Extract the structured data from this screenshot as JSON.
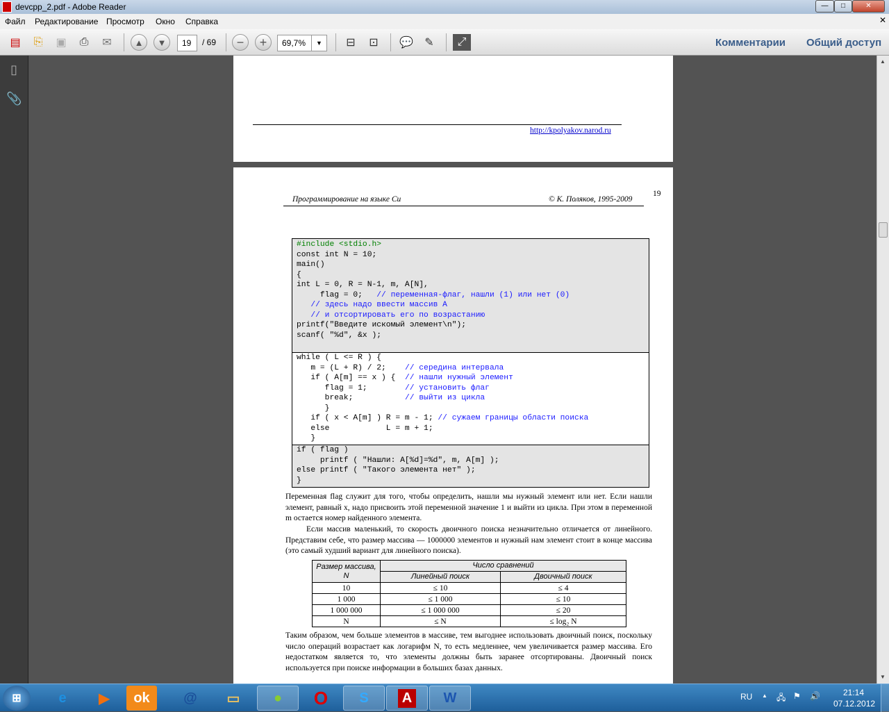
{
  "window": {
    "title": "devcpp_2.pdf - Adobe Reader",
    "min": "—",
    "max": "□",
    "close": "✕"
  },
  "menu": [
    "Файл",
    "Редактирование",
    "Просмотр",
    "Окно",
    "Справка"
  ],
  "toolbar": {
    "page_current": "19",
    "page_total": "/ 69",
    "zoom": "69,7%",
    "comments": "Комментарии",
    "share": "Общий доступ"
  },
  "page1": {
    "link": "http://kpolyakov.narod.ru"
  },
  "page2": {
    "header_left": "Программирование на языке Си",
    "header_right": "© К. Поляков, 1995-2009",
    "page_number": "19",
    "code_top": [
      {
        "parts": [
          {
            "t": "#include <stdio.h>",
            "c": "pp"
          }
        ]
      },
      {
        "parts": [
          {
            "t": "const int N = 10;"
          }
        ]
      },
      {
        "parts": [
          {
            "t": "main()"
          }
        ]
      },
      {
        "parts": [
          {
            "t": "{"
          }
        ]
      },
      {
        "parts": [
          {
            "t": "int L = 0, R = N-1, m, A[N],"
          }
        ]
      },
      {
        "parts": [
          {
            "t": "     flag = 0;   "
          },
          {
            "t": "// переменная-флаг, нашли (1) или нет (0)",
            "c": "cm"
          }
        ]
      },
      {
        "parts": [
          {
            "t": "   // здесь надо ввести массив A",
            "c": "cm"
          }
        ]
      },
      {
        "parts": [
          {
            "t": "   // и отсортировать его по возрастанию",
            "c": "cm"
          }
        ]
      },
      {
        "parts": [
          {
            "t": "printf(\"Введите искомый элемент\\n\");"
          }
        ]
      },
      {
        "parts": [
          {
            "t": "scanf( \"%d\", &x );"
          }
        ]
      }
    ],
    "code_mid": [
      {
        "parts": [
          {
            "t": "while ( L <= R ) {"
          }
        ]
      },
      {
        "parts": [
          {
            "t": "   m = (L + R) / 2;    "
          },
          {
            "t": "// середина интервала",
            "c": "cm"
          }
        ]
      },
      {
        "parts": [
          {
            "t": "   if ( A[m] == x ) {  "
          },
          {
            "t": "// нашли нужный элемент",
            "c": "cm"
          }
        ]
      },
      {
        "parts": [
          {
            "t": "      flag = 1;        "
          },
          {
            "t": "// установить флаг",
            "c": "cm"
          }
        ]
      },
      {
        "parts": [
          {
            "t": "      break;           "
          },
          {
            "t": "// выйти из цикла",
            "c": "cm"
          }
        ]
      },
      {
        "parts": [
          {
            "t": "      }"
          }
        ]
      },
      {
        "parts": [
          {
            "t": "   if ( x < A[m] ) R = m - 1; "
          },
          {
            "t": "// сужаем границы области поиска",
            "c": "cm"
          }
        ]
      },
      {
        "parts": [
          {
            "t": "   else            L = m + 1;"
          }
        ]
      },
      {
        "parts": [
          {
            "t": "   }"
          }
        ]
      }
    ],
    "code_bot": [
      {
        "parts": [
          {
            "t": "if ( flag )"
          }
        ]
      },
      {
        "parts": [
          {
            "t": "     printf ( \"Нашли: A[%d]=%d\", m, A[m] );"
          }
        ]
      },
      {
        "parts": [
          {
            "t": "else printf ( \"Такого элемента нет\" );"
          }
        ]
      },
      {
        "parts": [
          {
            "t": "}"
          }
        ]
      }
    ],
    "para1": "Переменная flag служит для того, чтобы определить, нашли мы нужный элемент или нет. Если нашли элемент, равный x, надо присвоить этой переменной значение 1 и выйти из цикла. При этом в переменной m остается номер найденного элемента.",
    "para2": "Если массив маленький, то скорость двоичного поиска незначительно отличается от линейного. Представим себе, что размер массива — 1000000 элементов и нужный нам элемент стоит в конце массива (это самый худший вариант для линейного поиска).",
    "table": {
      "h_size": "Размер массива, N",
      "h_comp": "Число сравнений",
      "h_lin": "Линейный поиск",
      "h_bin": "Двоичный поиск",
      "rows": [
        [
          "10",
          "≤ 10",
          "≤ 4"
        ],
        [
          "1 000",
          "≤ 1 000",
          "≤ 10"
        ],
        [
          "1 000 000",
          "≤ 1 000 000",
          "≤ 20"
        ],
        [
          "N",
          "≤ N",
          "≤ log₂ N"
        ]
      ]
    },
    "para3": "Таким образом, чем больше элементов в массиве, тем выгоднее использовать двоичный поиск, поскольку число операций возрастает как логарифм N, то есть медленнее, чем увеличивается размер массива. Его недостатком является то, что элементы должны быть заранее отсортированы. Двоичный поиск используется при поиске информации в больших базах данных."
  },
  "taskbar": {
    "lang": "RU",
    "time": "21:14",
    "date": "07.12.2012"
  }
}
